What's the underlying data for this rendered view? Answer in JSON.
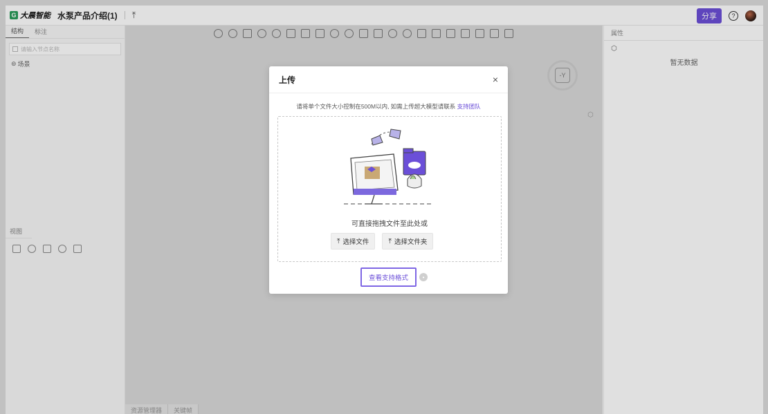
{
  "topbar": {
    "logo_letter": "G",
    "logo_text": "大晨智能",
    "project_title": "水泵产品介绍(1)",
    "share_label": "分享",
    "help_label": "?"
  },
  "left_panel": {
    "tabs": [
      "结构",
      "标注"
    ],
    "search_placeholder": "请输入节点名称",
    "tree_items": [
      "场景"
    ],
    "view_tab": "视图"
  },
  "canvas": {
    "bottom_tabs": [
      "资源管理器",
      "关键帧"
    ],
    "gizmo_label": "-Y"
  },
  "right_panel": {
    "tab": "属性",
    "empty_text": "暂无数据"
  },
  "modal": {
    "title": "上传",
    "close": "×",
    "notice_text": "请将单个文件大小控制在500M以内, 如需上传超大模型请联系 ",
    "notice_link": "支持团队",
    "drag_text": "可直接拖拽文件至此处或",
    "select_file": "选择文件",
    "select_folder": "选择文件夹",
    "view_formats": "查看支持格式"
  },
  "colors": {
    "accent": "#6b4fd8",
    "logo_green": "#2a9d5a"
  }
}
